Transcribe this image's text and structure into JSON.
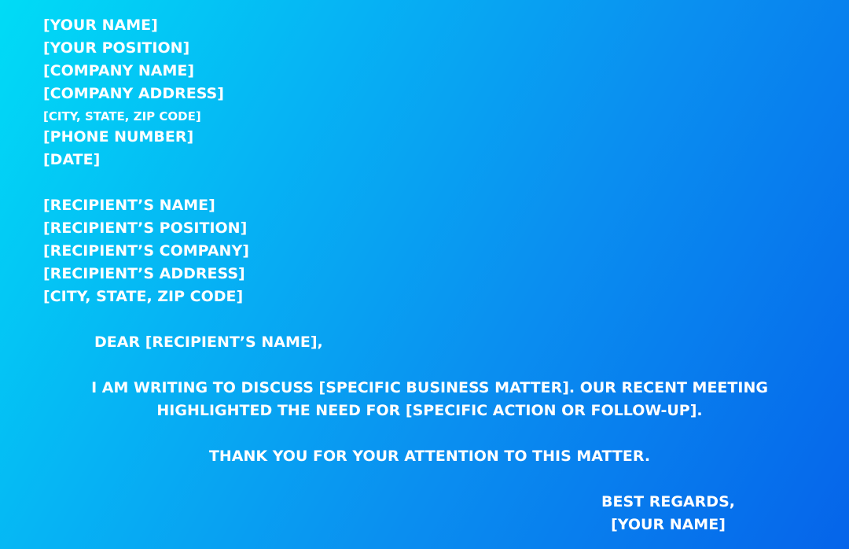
{
  "sender": {
    "name": "[YOUR NAME]",
    "position": "[YOUR POSITION]",
    "company": "[COMPANY NAME]",
    "address": "[COMPANY ADDRESS]",
    "city_state_zip": "[CITY, STATE, ZIP CODE]",
    "phone": "[PHONE NUMBER]",
    "date": "[DATE]"
  },
  "recipient": {
    "name": "[RECIPIENT’S NAME]",
    "position": "[RECIPIENT’S POSITION]",
    "company": "[RECIPIENT’S COMPANY]",
    "address": "[RECIPIENT’S ADDRESS]",
    "city_state_zip": "[CITY, STATE, ZIP CODE]"
  },
  "letter": {
    "salutation": "DEAR [RECIPIENT’S NAME],",
    "body_line1": "I AM WRITING TO DISCUSS [SPECIFIC BUSINESS MATTER]. OUR RECENT MEETING",
    "body_line2": "HIGHLIGHTED THE NEED FOR [SPECIFIC ACTION OR FOLLOW-UP].",
    "thanks": "THANK YOU FOR YOUR ATTENTION TO THIS MATTER.",
    "closing": "BEST REGARDS,",
    "signature": "[YOUR NAME]"
  },
  "colors": {
    "gradient_start": "#00dcf6",
    "gradient_end": "#0564ea",
    "text": "#ffffff"
  }
}
